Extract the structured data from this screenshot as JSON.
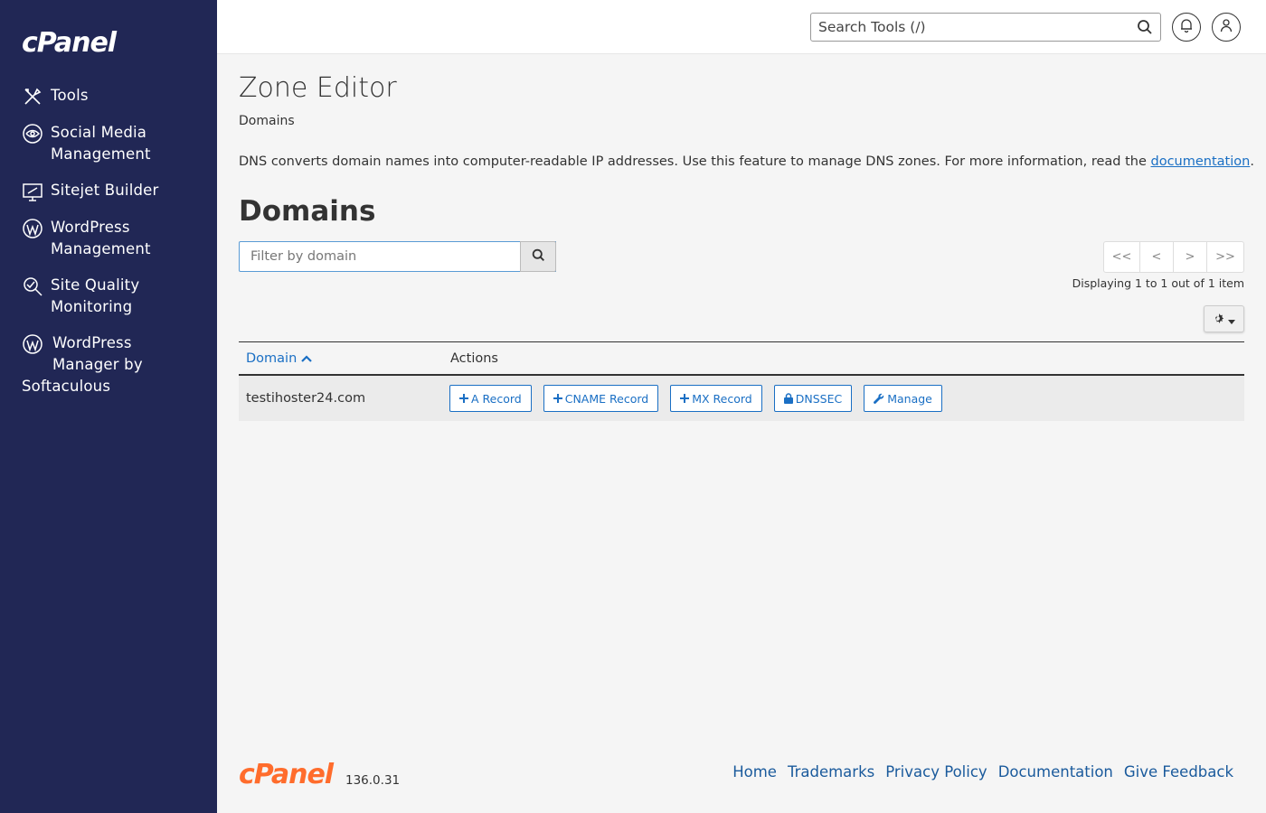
{
  "sidebar": {
    "logo": "cPanel",
    "items": [
      {
        "label": "Tools",
        "icon": "tools-icon"
      },
      {
        "label": "Social Media Management",
        "line1": "Social Media",
        "line2": "Management",
        "icon": "social-media-icon"
      },
      {
        "label": "Sitejet Builder",
        "icon": "sitejet-icon"
      },
      {
        "label": "WordPress Management",
        "line1": "WordPress",
        "line2": "Management",
        "icon": "wordpress-icon"
      },
      {
        "label": "Site Quality Monitoring",
        "line1": "Site Quality",
        "line2": "Monitoring",
        "icon": "site-quality-icon"
      },
      {
        "label": "WordPress Manager by Softaculous",
        "line1": "WordPress",
        "line2": "Manager by",
        "line3": "Softaculous",
        "icon": "wordpress-icon"
      }
    ]
  },
  "header": {
    "search_placeholder": "Search Tools (/)"
  },
  "main": {
    "title": "Zone Editor",
    "breadcrumb": "Domains",
    "description": "DNS converts domain names into computer-readable IP addresses. Use this feature to manage DNS zones. For more information, read the ",
    "doc_link": "documentation",
    "desc_end": ".",
    "section_title": "Domains",
    "filter_placeholder": "Filter by domain",
    "pager": {
      "first": "<<",
      "prev": "<",
      "next": ">",
      "last": ">>"
    },
    "paging_info": "Displaying 1 to 1 out of 1 item",
    "table": {
      "col_domain": "Domain",
      "col_actions": "Actions",
      "rows": [
        {
          "domain": "testihoster24.com",
          "actions": [
            "A Record",
            "CNAME Record",
            "MX Record",
            "DNSSEC",
            "Manage"
          ]
        }
      ]
    }
  },
  "footer": {
    "logo": "cPanel",
    "version": "136.0.31",
    "links": [
      "Home",
      "Trademarks",
      "Privacy Policy",
      "Documentation",
      "Give Feedback"
    ]
  },
  "colors": {
    "sidebar_bg": "#212755",
    "link": "#1a6fc4",
    "footer_logo": "#ff6c2c"
  }
}
